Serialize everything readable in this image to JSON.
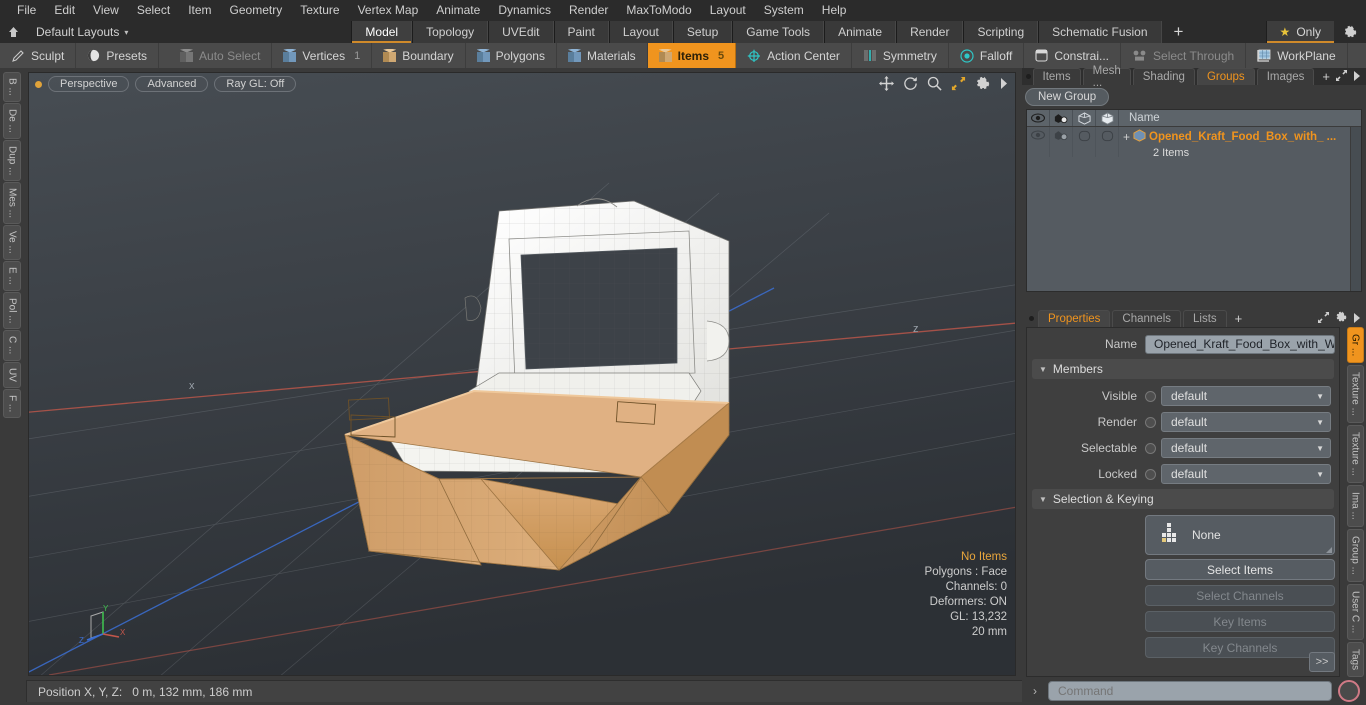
{
  "menubar": {
    "items": [
      "File",
      "Edit",
      "View",
      "Select",
      "Item",
      "Geometry",
      "Texture",
      "Vertex Map",
      "Animate",
      "Dynamics",
      "Render",
      "MaxToModo",
      "Layout",
      "System",
      "Help"
    ]
  },
  "layoutbar": {
    "home_icon": "home-icon",
    "default_layouts": "Default Layouts",
    "caret": "▾",
    "tabs": [
      {
        "label": "Model",
        "active": true
      },
      {
        "label": "Topology",
        "active": false
      },
      {
        "label": "UVEdit",
        "active": false
      },
      {
        "label": "Paint",
        "active": false
      },
      {
        "label": "Layout",
        "active": false
      },
      {
        "label": "Setup",
        "active": false
      },
      {
        "label": "Game Tools",
        "active": false
      },
      {
        "label": "Animate",
        "active": false
      },
      {
        "label": "Render",
        "active": false
      },
      {
        "label": "Scripting",
        "active": false
      },
      {
        "label": "Schematic Fusion",
        "active": false
      }
    ],
    "add_tab": "+",
    "only_label": "Only",
    "star_icon": "star-icon",
    "gear_icon": "gear-icon",
    "accent": "#d08a2a"
  },
  "modebar": {
    "sculpt": "Sculpt",
    "presets": "Presets",
    "auto_select": "Auto Select",
    "vertices": "Vertices",
    "vertices_badge": "1",
    "boundary": "Boundary",
    "polygons": "Polygons",
    "materials": "Materials",
    "items": "Items",
    "items_badge": "5",
    "action_center": "Action Center",
    "symmetry": "Symmetry",
    "falloff": "Falloff",
    "constrain": "Constrai...",
    "select_through": "Select Through",
    "workplane": "WorkPlane",
    "selected_accent": "#f0941e"
  },
  "left_rail": {
    "tabs": [
      "B ...",
      "De ...",
      "Dup ...",
      "Mes ...",
      "Ve ...",
      "E ...",
      "Pol ...",
      "C ...",
      "UV",
      "F ..."
    ]
  },
  "viewport": {
    "mode": "Perspective",
    "quality": "Advanced",
    "raygl": "Ray GL: Off",
    "icons": [
      "move-icon",
      "rotate-icon",
      "zoom-icon",
      "fit-icon",
      "gear-icon",
      "chevron-right-icon"
    ],
    "stats": {
      "selection": "No Items",
      "polygons": "Polygons : Face",
      "channels": "Channels: 0",
      "deformers": "Deformers: ON",
      "gl": "GL: 13,232",
      "scale": "20 mm"
    },
    "axis": {
      "x": "X",
      "y": "Y",
      "z": "Z"
    },
    "colors": {
      "background_top": "#3b4046",
      "background_bottom": "#2e3338",
      "box_kraft": "#d4a06a",
      "box_kraft_dark": "#b8854f",
      "box_white": "#f4f4f2",
      "window_dark": "#3c4147",
      "axis_x": "#c4564a",
      "axis_y": "#4caf50",
      "axis_z": "#3b6fd4"
    }
  },
  "statusbar": {
    "label": "Position X, Y, Z:",
    "value": "0 m, 132 mm, 186 mm"
  },
  "right_panel": {
    "tabs": [
      {
        "label": "Items",
        "active": false
      },
      {
        "label": "Mesh ...",
        "active": false
      },
      {
        "label": "Shading",
        "active": false
      },
      {
        "label": "Groups",
        "active": true
      },
      {
        "label": "Images",
        "active": false
      }
    ],
    "add_tab": "+",
    "expand_icon": "expand-icon",
    "more_icon": "chevron-right-icon",
    "new_group_button": "New Group",
    "list": {
      "columns": [
        "eye-icon",
        "render-icon",
        "shape-icon",
        "shape-filled-icon"
      ],
      "name_header": "Name",
      "rows": [
        {
          "expander": "+",
          "icon": "group-icon",
          "name": "Opened_Kraft_Food_Box_with_ ...",
          "sub": "2 Items"
        }
      ]
    }
  },
  "properties": {
    "tabs": [
      {
        "label": "Properties",
        "active": true
      },
      {
        "label": "Channels",
        "active": false
      },
      {
        "label": "Lists",
        "active": false
      }
    ],
    "add_tab": "+",
    "name_label": "Name",
    "name_value": "Opened_Kraft_Food_Box_with_Windo",
    "members_section": "Members",
    "members": [
      {
        "label": "Visible",
        "value": "default"
      },
      {
        "label": "Render",
        "value": "default"
      },
      {
        "label": "Selectable",
        "value": "default"
      },
      {
        "label": "Locked",
        "value": "default"
      }
    ],
    "selection_section": "Selection & Keying",
    "selection_preset": "None",
    "buttons": [
      {
        "label": "Select Items",
        "disabled": false
      },
      {
        "label": "Select Channels",
        "disabled": true
      },
      {
        "label": "Key Items",
        "disabled": true
      },
      {
        "label": "Key Channels",
        "disabled": true
      }
    ],
    "goto_button": ">>"
  },
  "right_rail": {
    "tabs": [
      {
        "label": "Gr ...",
        "active": true
      },
      {
        "label": "Texture ...",
        "active": false
      },
      {
        "label": "Texture ...",
        "active": false
      },
      {
        "label": "Ima ...",
        "active": false
      },
      {
        "label": "Group ...",
        "active": false
      },
      {
        "label": "User C ...",
        "active": false
      },
      {
        "label": "Tags",
        "active": false
      }
    ]
  },
  "command_bar": {
    "arrow": "›",
    "placeholder": "Command",
    "record_icon": "record-icon"
  }
}
